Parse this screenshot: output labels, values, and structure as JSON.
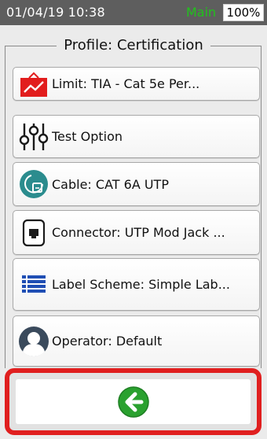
{
  "status": {
    "datetime": "01/04/19 10:38",
    "mode": "Main",
    "battery": "100%"
  },
  "profile": {
    "title": "Profile: Certification"
  },
  "menu": {
    "items": [
      {
        "label": "Limit: TIA - Cat 5e Per...",
        "icon": "chart-limit-icon"
      },
      {
        "label": "Test Option",
        "icon": "sliders-icon"
      },
      {
        "label": "Cable: CAT 6A UTP",
        "icon": "cable-icon"
      },
      {
        "label": "Connector: UTP Mod Jack ...",
        "icon": "connector-jack-icon"
      },
      {
        "label": "Label Scheme: Simple Lab...",
        "icon": "list-icon"
      },
      {
        "label": "Operator: Default",
        "icon": "user-icon"
      }
    ]
  },
  "back": {
    "icon": "back-arrow-icon"
  },
  "colors": {
    "status_bar": "#5e5e5e",
    "mode_text": "#21c21c",
    "highlight_frame": "#e01f1f",
    "back_button": "#2aa12f"
  }
}
